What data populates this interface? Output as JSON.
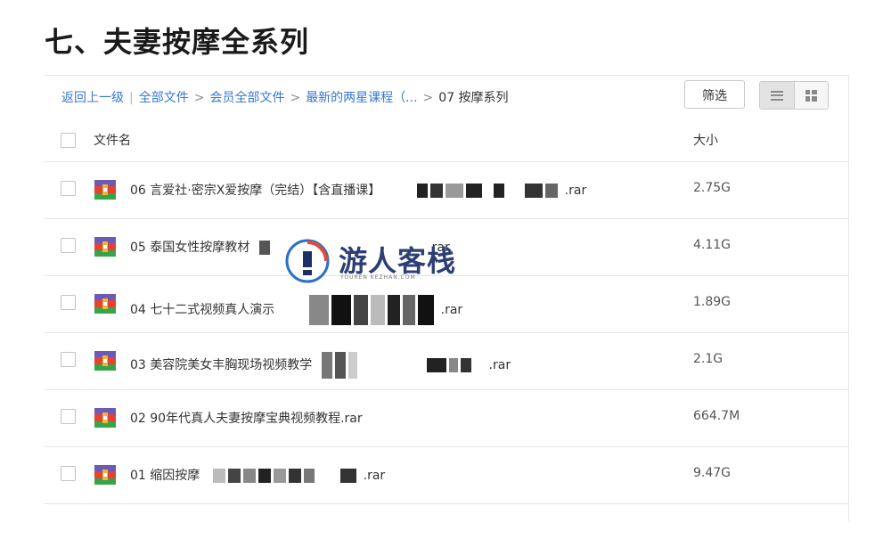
{
  "page": {
    "title": "七、夫妻按摩全系列"
  },
  "breadcrumb": {
    "back": "返回上一级",
    "divider": "|",
    "arrow": ">",
    "items": [
      "全部文件",
      "会员全部文件",
      "最新的两星课程（...",
      "07 按摩系列"
    ]
  },
  "toolbar": {
    "filter_label": "筛选",
    "view_modes": [
      "list-icon",
      "grid-icon"
    ],
    "active_view": "list"
  },
  "table": {
    "headers": {
      "name": "文件名",
      "size": "大小"
    },
    "rows": [
      {
        "name": "06 言爱社·密宗X爱按摩（完结）【含直播课】",
        "ext": ".rar",
        "size": "2.75G",
        "icon": "rar-archive-icon"
      },
      {
        "name": "05 泰国女性按摩教材",
        "ext": "rar",
        "size": "4.11G",
        "icon": "rar-archive-icon"
      },
      {
        "name": "04 七十二式视频真人演示",
        "ext": ".rar",
        "size": "1.89G",
        "icon": "rar-archive-icon"
      },
      {
        "name": "03 美容院美女丰胸现场视频教学",
        "ext": ".rar",
        "size": "2.1G",
        "icon": "rar-archive-icon"
      },
      {
        "name": "02 90年代真人夫妻按摩宝典视频教程.rar",
        "ext": "",
        "size": "664.7M",
        "icon": "rar-archive-icon"
      },
      {
        "name": "01 缩因按摩",
        "ext": ".rar",
        "size": "9.47G",
        "icon": "rar-archive-icon"
      }
    ]
  },
  "watermark": {
    "text": "游人客栈",
    "sub": "YOUREN KEZHAN.COM"
  },
  "colors": {
    "link": "#3778d0",
    "border": "#e6e6e6",
    "watermark": "#2c3e73"
  }
}
